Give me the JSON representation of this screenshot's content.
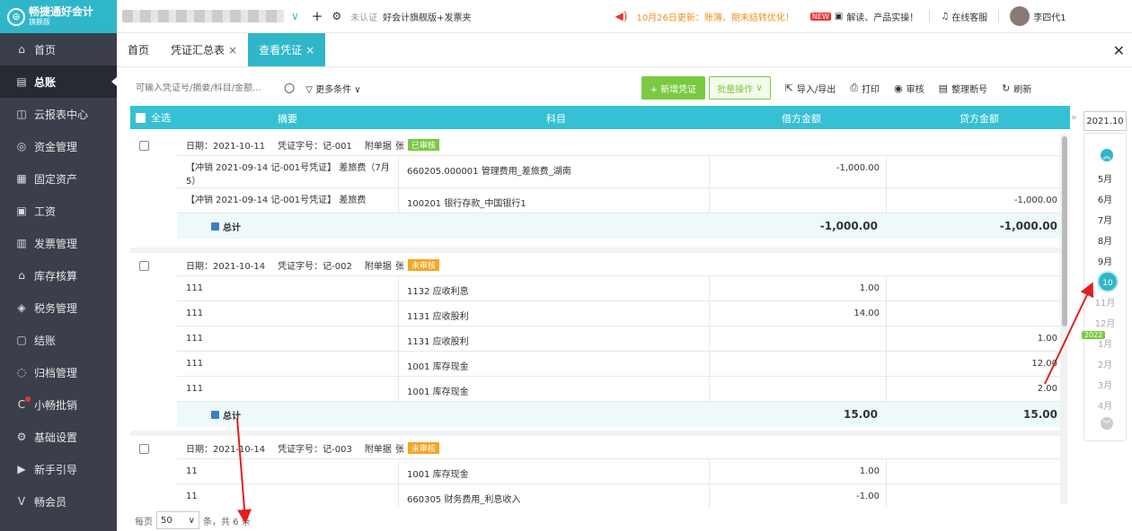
{
  "brand": {
    "name": "畅捷通好会计",
    "edition": "旗舰版",
    "logo_char": "⊕"
  },
  "sidebar": {
    "items": [
      {
        "label": "首页",
        "icon": "home-icon",
        "glyph": "⌂"
      },
      {
        "label": "总账",
        "icon": "ledger-icon",
        "glyph": "▤"
      },
      {
        "label": "云报表中心",
        "icon": "chart-icon",
        "glyph": "◫"
      },
      {
        "label": "资金管理",
        "icon": "money-icon",
        "glyph": "◎"
      },
      {
        "label": "固定资产",
        "icon": "asset-icon",
        "glyph": "▦"
      },
      {
        "label": "工资",
        "icon": "salary-icon",
        "glyph": "▣"
      },
      {
        "label": "发票管理",
        "icon": "invoice-icon",
        "glyph": "▥"
      },
      {
        "label": "库存核算",
        "icon": "inventory-icon",
        "glyph": "⌂"
      },
      {
        "label": "税务管理",
        "icon": "tax-icon",
        "glyph": "◈"
      },
      {
        "label": "结账",
        "icon": "checkout-icon",
        "glyph": "▢"
      },
      {
        "label": "归档管理",
        "icon": "archive-icon",
        "glyph": "◌"
      },
      {
        "label": "小畅批销",
        "icon": "wholesale-icon",
        "glyph": "C"
      },
      {
        "label": "基础设置",
        "icon": "settings-icon",
        "glyph": "⚙"
      },
      {
        "label": "新手引导",
        "icon": "guide-icon",
        "glyph": "▶"
      },
      {
        "label": "畅会员",
        "icon": "member-icon",
        "glyph": "V"
      }
    ]
  },
  "topbar": {
    "plus": "+",
    "gear": "⚙",
    "cert": "未认证",
    "version": "好会计旗舰版+发票夹",
    "notice": "10月26日更新：账簿、期末结转优化！",
    "new_badge": "NEW",
    "help": "解读、产品实操！",
    "service": "在线客服",
    "user": "李四代1"
  },
  "tabs": [
    {
      "label": "首页",
      "closable": false
    },
    {
      "label": "凭证汇总表",
      "closable": true
    },
    {
      "label": "查看凭证",
      "closable": true
    }
  ],
  "toolbar": {
    "search_placeholder": "可输入凭证号/摘要/科目/金额...",
    "more_filter": "更多条件",
    "new_voucher": "+ 新增凭证",
    "batch": "批量操作",
    "import_export": "导入/导出",
    "print": "打印",
    "audit": "审核",
    "renumber": "整理断号",
    "refresh": "刷新"
  },
  "table": {
    "headers": {
      "select_all": "全选",
      "summary": "摘要",
      "account": "科目",
      "debit": "借方金额",
      "credit": "贷方金额"
    },
    "vouchers": [
      {
        "date_label": "日期：2021-10-11",
        "no_label": "凭证字号：记-001",
        "attach_label": "附单据",
        "attach_unit": "张",
        "status": "已审核",
        "lines": [
          {
            "summary": "【冲销 2021-09-14 记-001号凭证】 差旅费（7月5）",
            "account": "660205.000001 管理费用_差旅费_湖南",
            "debit": "-1,000.00",
            "credit": ""
          },
          {
            "summary": "【冲销 2021-09-14 记-001号凭证】 差旅费",
            "account": "100201 银行存款_中国银行1",
            "debit": "",
            "credit": "-1,000.00"
          }
        ],
        "total_label": "总计",
        "total_debit": "-1,000.00",
        "total_credit": "-1,000.00"
      },
      {
        "date_label": "日期：2021-10-14",
        "no_label": "凭证字号：记-002",
        "attach_label": "附单据",
        "attach_unit": "张",
        "status": "未审核",
        "lines": [
          {
            "summary": "111",
            "account": "1132 应收利息",
            "debit": "1.00",
            "credit": ""
          },
          {
            "summary": "111",
            "account": "1131 应收股利",
            "debit": "14.00",
            "credit": ""
          },
          {
            "summary": "111",
            "account": "1131 应收股利",
            "debit": "",
            "credit": "1.00"
          },
          {
            "summary": "111",
            "account": "1001 库存现金",
            "debit": "",
            "credit": "12.00"
          },
          {
            "summary": "111",
            "account": "1001 库存现金",
            "debit": "",
            "credit": "2.00"
          }
        ],
        "total_label": "总计",
        "total_debit": "15.00",
        "total_credit": "15.00"
      },
      {
        "date_label": "日期：2021-10-14",
        "no_label": "凭证字号：记-003",
        "attach_label": "附单据",
        "attach_unit": "张",
        "status": "未审核",
        "lines": [
          {
            "summary": "11",
            "account": "1001 库存现金",
            "debit": "1.00",
            "credit": ""
          },
          {
            "summary": "11",
            "account": "660305 财务费用_利息收入",
            "debit": "-1.00",
            "credit": ""
          }
        ]
      }
    ]
  },
  "period": {
    "current": "2021.10",
    "year_badge": "2022",
    "months": [
      "5月",
      "6月",
      "7月",
      "8月",
      "9月",
      "10月",
      "11月",
      "12月",
      "1月",
      "2月",
      "3月",
      "4月"
    ],
    "selected_index": 5
  },
  "footer": {
    "per_page": "每页",
    "page_size": "50",
    "items_suffix": "条，共 6 条"
  },
  "colors": {
    "accent": "#2fb7c9",
    "green": "#7ac943",
    "sidebar": "#3a3f4b",
    "header": "#36c0d3"
  }
}
